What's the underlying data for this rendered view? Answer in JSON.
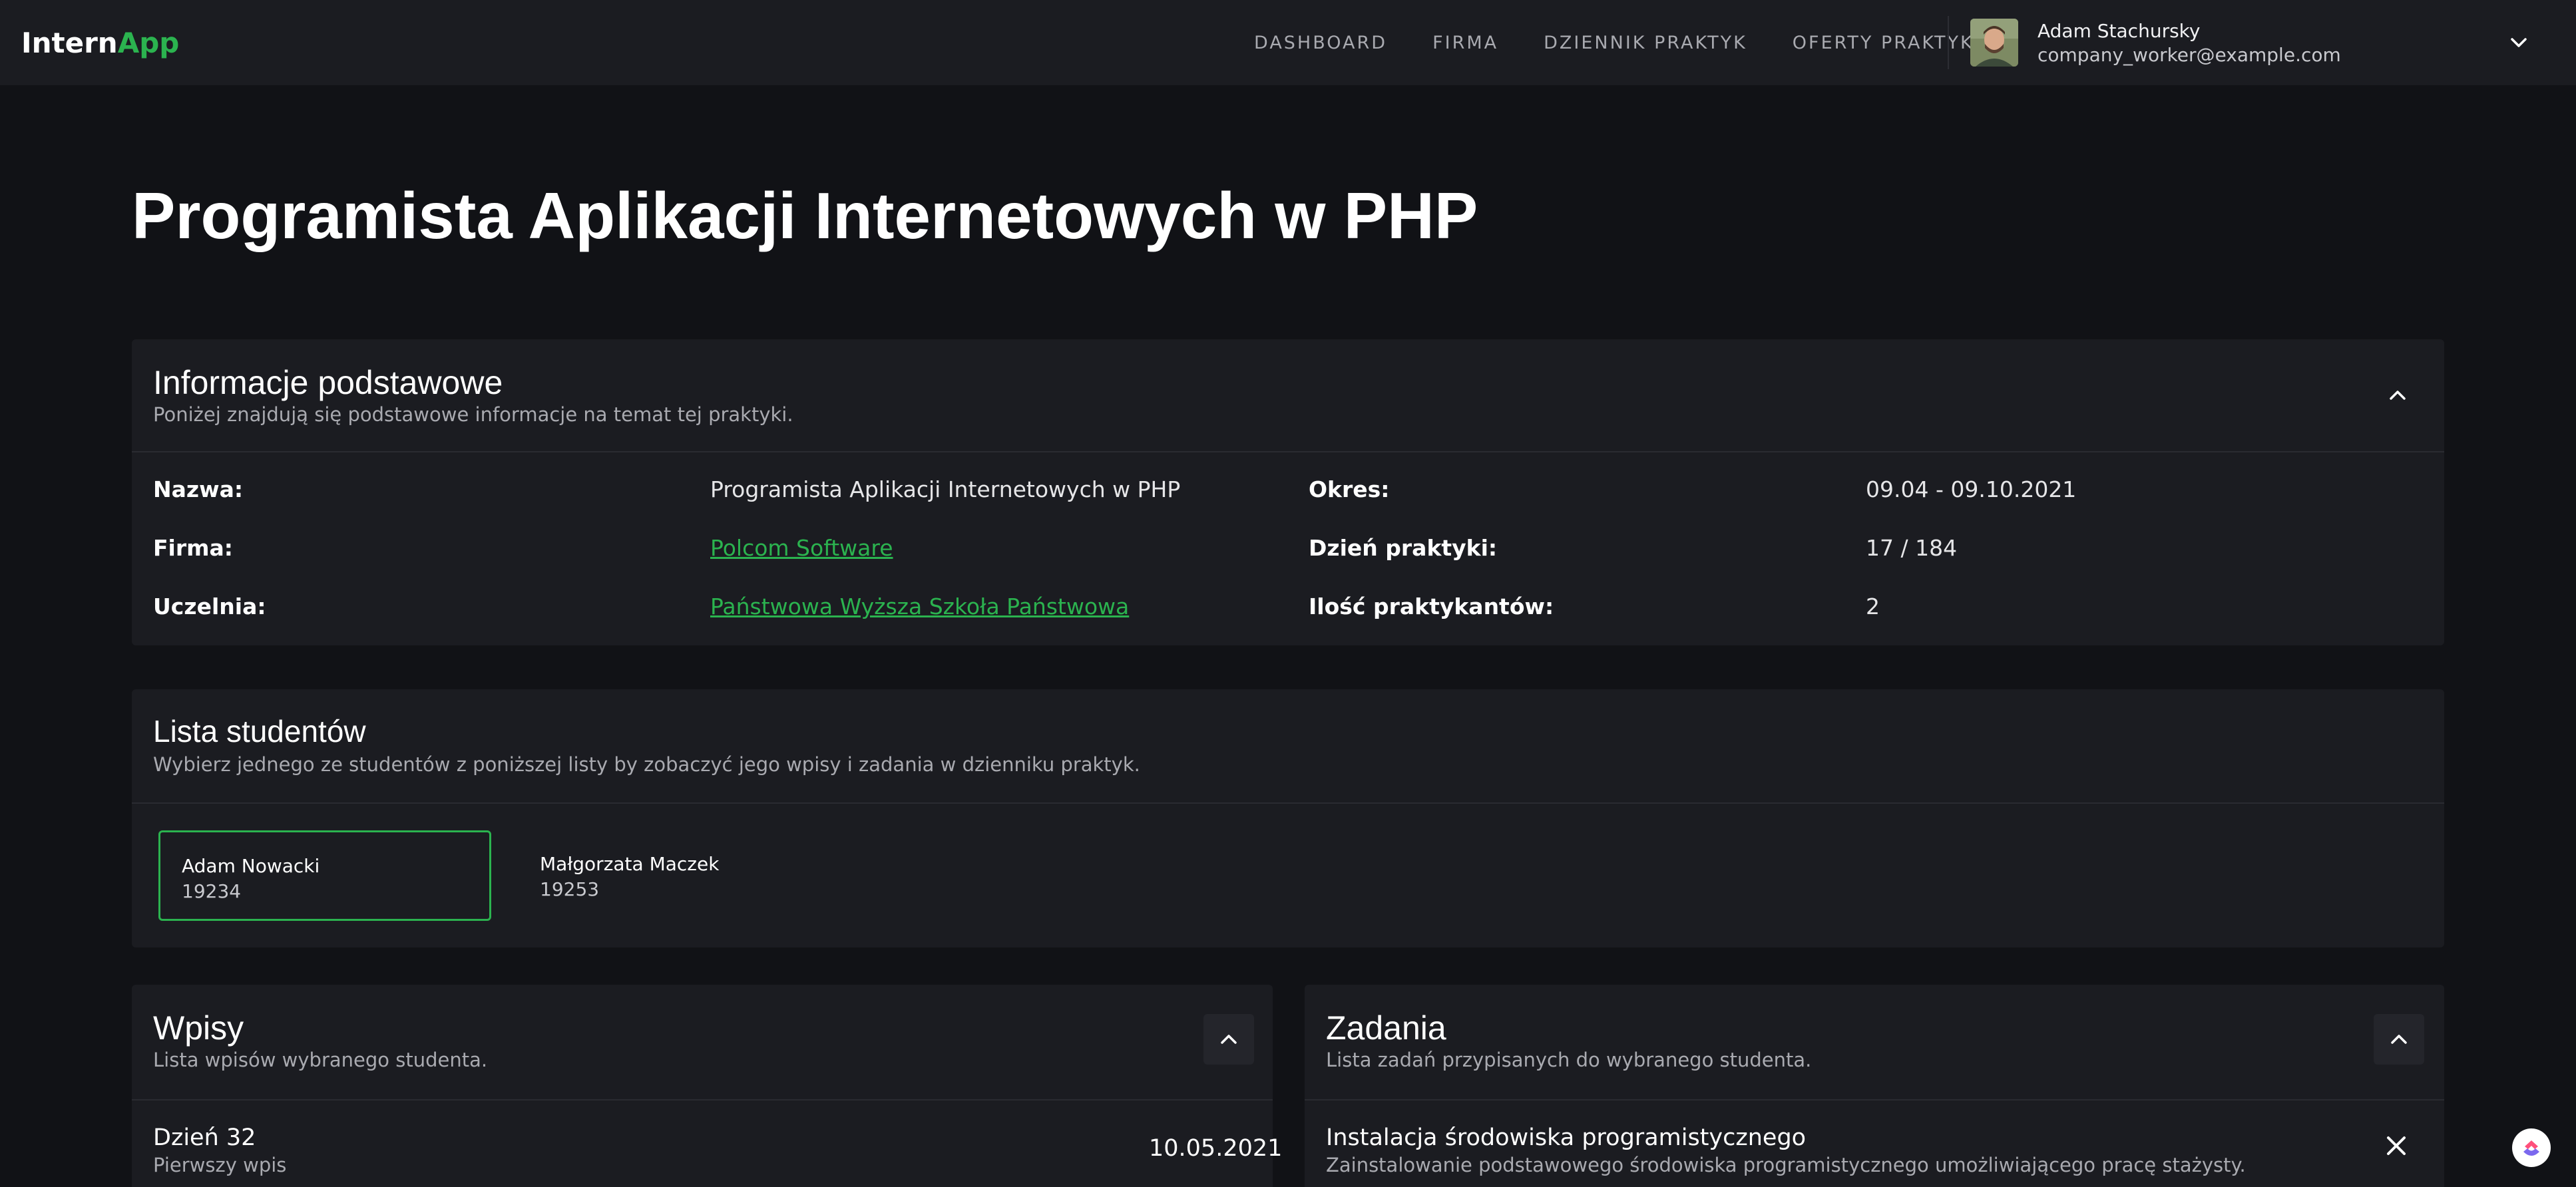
{
  "app": {
    "logo_main": "Intern",
    "logo_accent": "App",
    "accent_color": "#2bb34f"
  },
  "nav": {
    "items": [
      "DASHBOARD",
      "FIRMA",
      "DZIENNIK PRAKTYK",
      "OFERTY PRAKTYK"
    ]
  },
  "user": {
    "name": "Adam Stachursky",
    "email": "company_worker@example.com",
    "avatar_icon": "user-avatar"
  },
  "page": {
    "title": "Programista Aplikacji Internetowych w PHP"
  },
  "info": {
    "title": "Informacje podstawowe",
    "subtitle": "Poniżej znajdują się podstawowe informacje na temat tej praktyki.",
    "fields": {
      "name_label": "Nazwa:",
      "name_value": "Programista Aplikacji Internetowych w PHP",
      "company_label": "Firma:",
      "company_value": "Polcom Software",
      "university_label": "Uczelnia:",
      "university_value": "Państwowa Wyższa Szkoła Państwowa",
      "period_label": "Okres:",
      "period_value": "09.04 - 09.10.2021",
      "day_label": "Dzień praktyki:",
      "day_value": "17 / 184",
      "interns_label": "Ilość praktykantów:",
      "interns_value": "2"
    }
  },
  "students": {
    "title": "Lista studentów",
    "subtitle": "Wybierz jednego ze studentów z poniższej listy by zobaczyć jego wpisy i zadania w dzienniku praktyk.",
    "items": [
      {
        "name": "Adam Nowacki",
        "id": "19234",
        "selected": true
      },
      {
        "name": "Małgorzata Maczek",
        "id": "19253",
        "selected": false
      }
    ]
  },
  "entries": {
    "title": "Wpisy",
    "subtitle": "Lista wpisów wybranego studenta.",
    "items": [
      {
        "title": "Dzień 32",
        "subtitle": "Pierwszy wpis",
        "date": "10.05.2021"
      }
    ]
  },
  "tasks": {
    "title": "Zadania",
    "subtitle": "Lista zadań przypisanych do wybranego studenta.",
    "items": [
      {
        "title": "Instalacja środowiska programistycznego",
        "subtitle": "Zainstalowanie podstawowego środowiska programistycznego umożliwiającego pracę stażysty."
      }
    ]
  }
}
